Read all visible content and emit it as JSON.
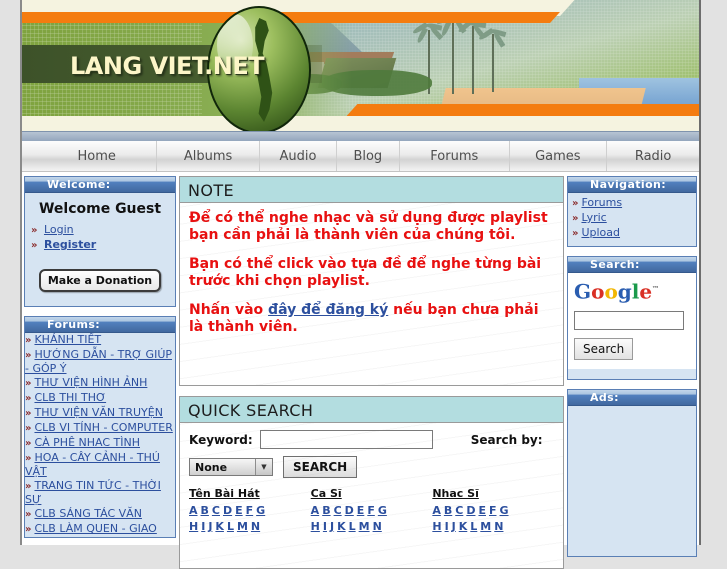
{
  "site": {
    "logo_text": "LANG VIET.NET"
  },
  "nav": {
    "items": [
      {
        "label": "Home"
      },
      {
        "label": "Albums"
      },
      {
        "label": "Audio"
      },
      {
        "label": "Blog"
      },
      {
        "label": "Forums"
      },
      {
        "label": "Games"
      },
      {
        "label": "Radio"
      }
    ]
  },
  "left": {
    "welcome": {
      "title": "Welcome:",
      "guest_text": "Welcome Guest",
      "links": [
        {
          "label": "Login"
        },
        {
          "label": "Register"
        }
      ],
      "donate_label": "Make a Donation"
    },
    "forums": {
      "title": "Forums:",
      "items": [
        {
          "label": "KHÁNH TIẾT"
        },
        {
          "label": "HƯỚNG DẪN - TRỢ GIÚP - GÓP Ý"
        },
        {
          "label": "THƯ VIỆN HÌNH ẢNH"
        },
        {
          "label": "CLB THI THƠ"
        },
        {
          "label": "THƯ VIỆN VĂN TRUYỆN"
        },
        {
          "label": "CLB VI TÍNH - COMPUTER"
        },
        {
          "label": "CÀ PHÊ NHAC TÌNH"
        },
        {
          "label": "HOA - CÂY CẢNH - THÚ VẬT"
        },
        {
          "label": "TRANG TIN TỨC - THỜI SỰ"
        },
        {
          "label": "CLB SÁNG TÁC VĂN"
        },
        {
          "label": "CLB LÀM QUEN - GIAO"
        }
      ]
    }
  },
  "main": {
    "note": {
      "title": "NOTE",
      "p1": "Để có thể nghe nhạc và sử dụng được playlist bạn cần phải là thành viên của chúng tôi.",
      "p2": "Bạn có thể click vào tựa đề để nghe từng bài trước khi chọn playlist.",
      "p3_before": "Nhấn vào ",
      "p3_link": "đây để đăng ký",
      "p3_after": " nếu bạn chưa phải là thành viên."
    },
    "quick_search": {
      "title": "QUICK SEARCH",
      "keyword_label": "Keyword:",
      "keyword_value": "",
      "keyword_placeholder": "",
      "search_by_label": "Search by:",
      "select_value": "None",
      "select_options": [
        "None"
      ],
      "search_button": "SEARCH",
      "columns": [
        {
          "title": "Tên Bài Hát",
          "row1": [
            "A",
            "B",
            "C",
            "D",
            "E",
            "F",
            "G"
          ],
          "row2": [
            "H",
            "I",
            "J",
            "K",
            "L",
            "M",
            "N"
          ]
        },
        {
          "title": "Ca Sĩ",
          "row1": [
            "A",
            "B",
            "C",
            "D",
            "E",
            "F",
            "G"
          ],
          "row2": [
            "H",
            "I",
            "J",
            "K",
            "L",
            "M",
            "N"
          ]
        },
        {
          "title": "Nhac Sĩ",
          "row1": [
            "A",
            "B",
            "C",
            "D",
            "E",
            "F",
            "G"
          ],
          "row2": [
            "H",
            "I",
            "J",
            "K",
            "L",
            "M",
            "N"
          ]
        }
      ]
    }
  },
  "right": {
    "navigation": {
      "title": "Navigation:",
      "items": [
        {
          "label": "Forums"
        },
        {
          "label": "Lyric"
        },
        {
          "label": "Upload"
        }
      ]
    },
    "search": {
      "title": "Search:",
      "logo": {
        "g1": "G",
        "o1": "o",
        "o2": "o",
        "g2": "g",
        "l": "l",
        "e": "e",
        "tm": "™"
      },
      "input_value": "",
      "button_label": "Search"
    },
    "ads": {
      "title": "Ads:"
    }
  },
  "colors": {
    "accent_orange": "#f47c10",
    "panel_header_blue": "#41689f",
    "panel_bg": "#d6e4f2",
    "box_header_teal": "#b3dde0",
    "note_red": "#e81010",
    "link_blue": "#2c4f9e"
  }
}
